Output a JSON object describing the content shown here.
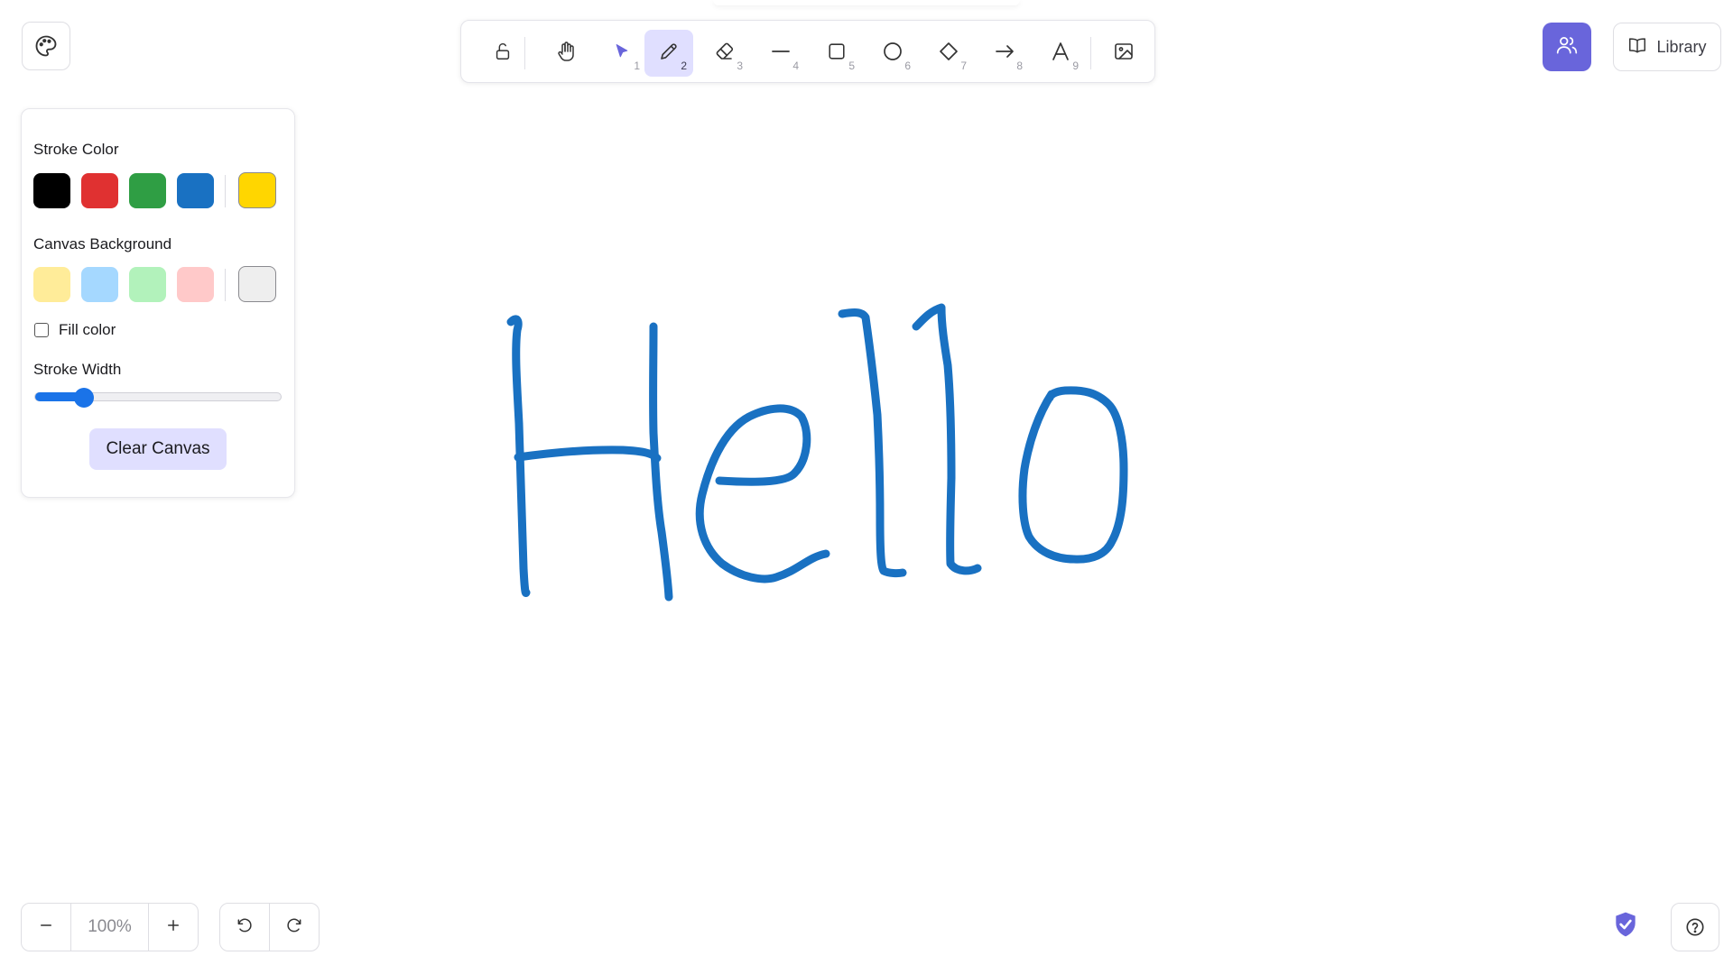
{
  "colors": {
    "accent": "#6965db",
    "active_tool_bg": "#e0dfff",
    "stroke_blue": "#1971c2",
    "slider_blue": "#1a73e8"
  },
  "top_left": {
    "palette_icon": "palette-icon"
  },
  "toolbar": {
    "tools": [
      {
        "name": "lock",
        "icon": "lock-open-icon",
        "key": ""
      },
      {
        "name": "hand",
        "icon": "hand-icon",
        "key": ""
      },
      {
        "name": "selection",
        "icon": "cursor-icon",
        "key": "1"
      },
      {
        "name": "draw",
        "icon": "pencil-icon",
        "key": "2",
        "active": true
      },
      {
        "name": "eraser",
        "icon": "eraser-icon",
        "key": "3"
      },
      {
        "name": "line",
        "icon": "line-icon",
        "key": "4"
      },
      {
        "name": "rectangle",
        "icon": "rectangle-icon",
        "key": "5"
      },
      {
        "name": "ellipse",
        "icon": "ellipse-icon",
        "key": "6"
      },
      {
        "name": "diamond",
        "icon": "diamond-icon",
        "key": "7"
      },
      {
        "name": "arrow",
        "icon": "arrow-icon",
        "key": "8"
      },
      {
        "name": "text",
        "icon": "text-icon",
        "key": "9"
      },
      {
        "name": "image",
        "icon": "image-icon",
        "key": ""
      }
    ]
  },
  "header_right": {
    "share_icon": "users-icon",
    "library_label": "Library"
  },
  "panel": {
    "stroke_color_label": "Stroke Color",
    "stroke_colors": [
      "#000000",
      "#e03131",
      "#2f9e44",
      "#1971c2"
    ],
    "stroke_current": "#ffd600",
    "background_label": "Canvas Background",
    "background_colors": [
      "#ffec99",
      "#a5d8ff",
      "#b2f2bb",
      "#ffc9c9"
    ],
    "background_current": "#eeeeee",
    "fill_label": "Fill color",
    "fill_checked": false,
    "stroke_width_label": "Stroke Width",
    "stroke_width_fraction": 0.2,
    "clear_label": "Clear Canvas"
  },
  "footer": {
    "zoom_out": "−",
    "zoom_level": "100%",
    "zoom_in": "+",
    "undo_icon": "undo-icon",
    "redo_icon": "redo-icon",
    "shield_icon": "shield-check-icon",
    "help_icon": "help-icon"
  },
  "drawing": {
    "content": "Hello",
    "stroke_color": "#1971c2"
  }
}
